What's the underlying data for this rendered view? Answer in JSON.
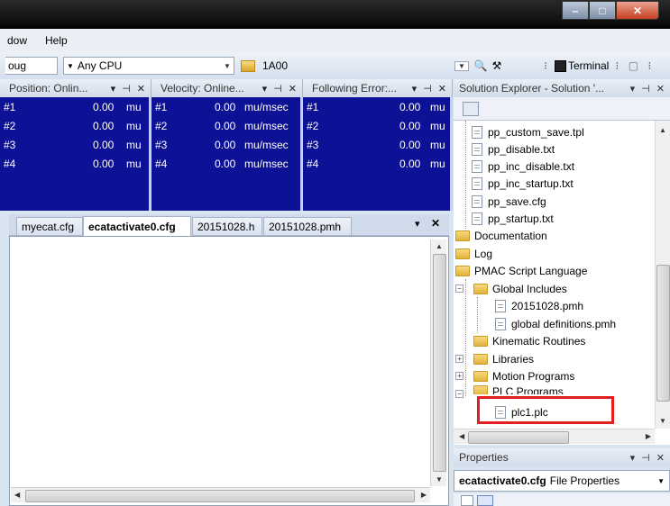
{
  "menubar": {
    "items": [
      "dow",
      "Help"
    ]
  },
  "toolbar": {
    "config_combo": "oug",
    "platform_combo": "Any CPU",
    "address_combo": "1A00",
    "terminal_label": "Terminal"
  },
  "panes": [
    {
      "title": "Position: Onlin...",
      "rows": [
        {
          "id": "#1",
          "value": "0.00",
          "unit": "mu"
        },
        {
          "id": "#2",
          "value": "0.00",
          "unit": "mu"
        },
        {
          "id": "#3",
          "value": "0.00",
          "unit": "mu"
        },
        {
          "id": "#4",
          "value": "0.00",
          "unit": "mu"
        }
      ]
    },
    {
      "title": "Velocity: Online...",
      "rows": [
        {
          "id": "#1",
          "value": "0.00",
          "unit": "mu/msec"
        },
        {
          "id": "#2",
          "value": "0.00",
          "unit": "mu/msec"
        },
        {
          "id": "#3",
          "value": "0.00",
          "unit": "mu/msec"
        },
        {
          "id": "#4",
          "value": "0.00",
          "unit": "mu/msec"
        }
      ]
    },
    {
      "title": "Following Error:...",
      "rows": [
        {
          "id": "#1",
          "value": "0.00",
          "unit": "mu"
        },
        {
          "id": "#2",
          "value": "0.00",
          "unit": "mu"
        },
        {
          "id": "#3",
          "value": "0.00",
          "unit": "mu"
        },
        {
          "id": "#4",
          "value": "0.00",
          "unit": "mu"
        }
      ]
    }
  ],
  "editor": {
    "tabs": [
      "myecat.cfg",
      "ecatactivate0.cfg",
      "20151028.h",
      "20151028.pmh"
    ],
    "active_tab": "ecatactivate0.cfg"
  },
  "solution_explorer": {
    "title": "Solution Explorer - Solution '...",
    "tree": [
      "pp_custom_save.tpl",
      "pp_disable.txt",
      "pp_inc_disable.txt",
      "pp_inc_startup.txt",
      "pp_save.cfg",
      "pp_startup.txt",
      "Documentation",
      "Log",
      "PMAC Script Language",
      "Global Includes",
      "20151028.pmh",
      "global definitions.pmh",
      "Kinematic Routines",
      "Libraries",
      "Motion Programs",
      "PLC Programs",
      "plc1.plc"
    ]
  },
  "properties": {
    "title": "Properties",
    "object_name": "ecatactivate0.cfg",
    "object_type": "File Properties"
  },
  "colors": {
    "watch_bg": "#0d1196",
    "highlight": "#e31e1e"
  }
}
